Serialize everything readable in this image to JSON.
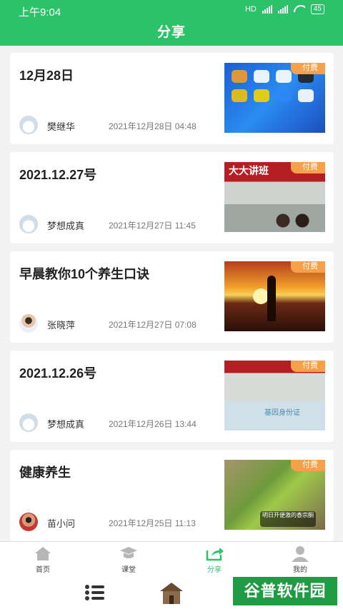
{
  "status_bar": {
    "time": "上午9:04",
    "network": "HD",
    "battery": "45"
  },
  "header": {
    "title": "分享"
  },
  "posts": [
    {
      "title": "12月28日",
      "author": "樊继华",
      "date": "2021年12月28日 04:48",
      "badge": "付费",
      "thumb": "phone-homescreen"
    },
    {
      "title": "2021.12.27号",
      "author": "梦想成真",
      "date": "2021年12月27日 11:45",
      "badge": "付费",
      "thumb": "lecture-screen"
    },
    {
      "title": "早晨教你10个养生口诀",
      "author": "张晓萍",
      "date": "2021年12月27日 07:08",
      "badge": "付费",
      "thumb": "sunset-beach"
    },
    {
      "title": "2021.12.26号",
      "author": "梦想成真",
      "date": "2021年12月26日 13:44",
      "badge": "付费",
      "thumb": "classroom-slide"
    },
    {
      "title": "健康养生",
      "author": "苗小问",
      "date": "2021年12月25日 11:13",
      "badge": "付费",
      "thumb": "green-vegetable"
    }
  ],
  "thumb_text": {
    "lecture_banner": "大大讲班",
    "slide_caption": "基因身份证",
    "video_caption": "明日开便激的香宗酮"
  },
  "tabs": [
    {
      "label": "首页",
      "icon": "home-icon"
    },
    {
      "label": "课堂",
      "icon": "graduation-cap-icon"
    },
    {
      "label": "分享",
      "icon": "share-icon"
    },
    {
      "label": "我的",
      "icon": "user-icon"
    }
  ],
  "watermark": "谷普软件园",
  "colors": {
    "primary": "#2bc26a",
    "badge": "#f6a14a"
  }
}
